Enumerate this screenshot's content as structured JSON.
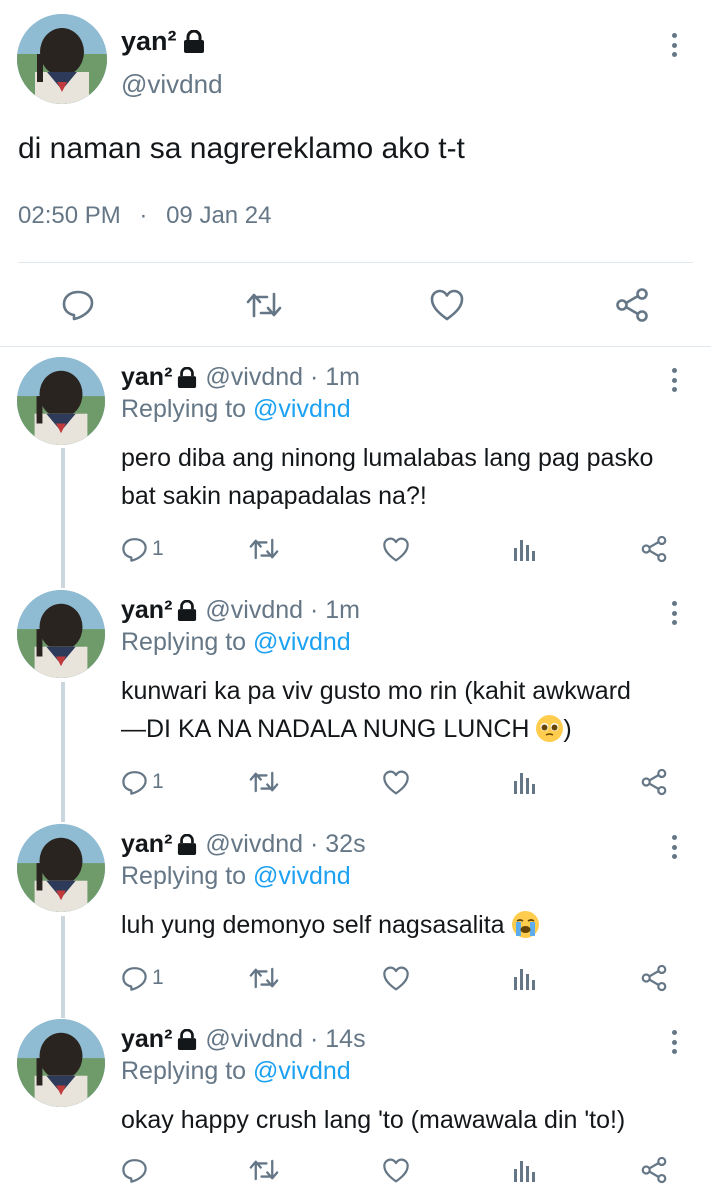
{
  "main_tweet": {
    "name": "yan²",
    "handle": "@vivdnd",
    "text": "di naman sa nagrereklamo ako t-t",
    "time": "02:50 PM",
    "separator": "·",
    "date": "09 Jan 24"
  },
  "replies": [
    {
      "name": "yan²",
      "handle_time": "@vivdnd · 1m",
      "replying_prefix": "Replying to",
      "replying_to": "@vivdnd",
      "line1": "pero diba ang ninong lumalabas lang pag pasko",
      "line2": "bat sakin napapadalas na?!",
      "reply_count": "1"
    },
    {
      "name": "yan²",
      "handle_time": "@vivdnd · 1m",
      "replying_prefix": "Replying to",
      "replying_to": "@vivdnd",
      "line1": "kunwari ka pa viv gusto mo rin (kahit awkward",
      "line2": "—DI KA NA NADALA NUNG LUNCH",
      "line2_end": ")",
      "reply_count": "1"
    },
    {
      "name": "yan²",
      "handle_time": "@vivdnd · 32s",
      "replying_prefix": "Replying to",
      "replying_to": "@vivdnd",
      "line1": "luh yung demonyo self nagsasalita",
      "reply_count": "1"
    },
    {
      "name": "yan²",
      "handle_time": "@vivdnd · 14s",
      "replying_prefix": "Replying to",
      "replying_to": "@vivdnd",
      "line1": "okay happy crush lang 'to (mawawala din 'to!)",
      "reply_count": ""
    }
  ],
  "icons": {
    "lock": "lock-icon",
    "more": "more-vertical-icon",
    "reply": "comment-icon",
    "retweet": "retweet-icon",
    "like": "heart-icon",
    "analytics": "analytics-icon",
    "share": "share-icon",
    "emoji_pleading": "pleading-face-emoji",
    "emoji_crying": "loudly-crying-face-emoji"
  },
  "colors": {
    "text": "#14171a",
    "secondary": "#657786",
    "link": "#1da1f2",
    "divider": "#e1e8ed",
    "thread_line": "#ccd6dd"
  }
}
